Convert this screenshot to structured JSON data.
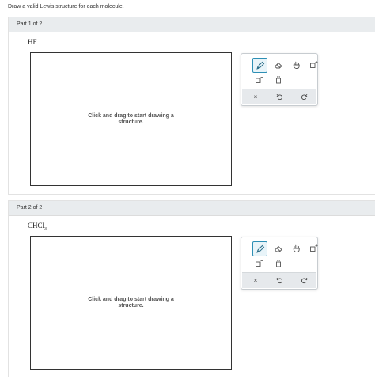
{
  "instruction": "Draw a valid Lewis structure for each molecule.",
  "parts": [
    {
      "header": "Part 1 of 2",
      "molecule": {
        "main": "HF",
        "subscript": ""
      },
      "canvas_prompt": "Click and drag to start drawing a structure."
    },
    {
      "header": "Part 2 of 2",
      "molecule": {
        "main": "CHCl",
        "subscript": "3"
      },
      "canvas_prompt": "Click and drag to start drawing a structure."
    }
  ],
  "toolbar": {
    "tools": [
      "pencil-icon",
      "eraser-icon",
      "hand-icon",
      "square-plus-icon",
      "square-minus-icon",
      "lone-pair-icon"
    ],
    "actions": [
      "clear-icon",
      "undo-icon",
      "redo-icon"
    ],
    "clear_symbol": "×",
    "active_tool": "pencil-icon",
    "accent_color": "#2d8fb5"
  }
}
